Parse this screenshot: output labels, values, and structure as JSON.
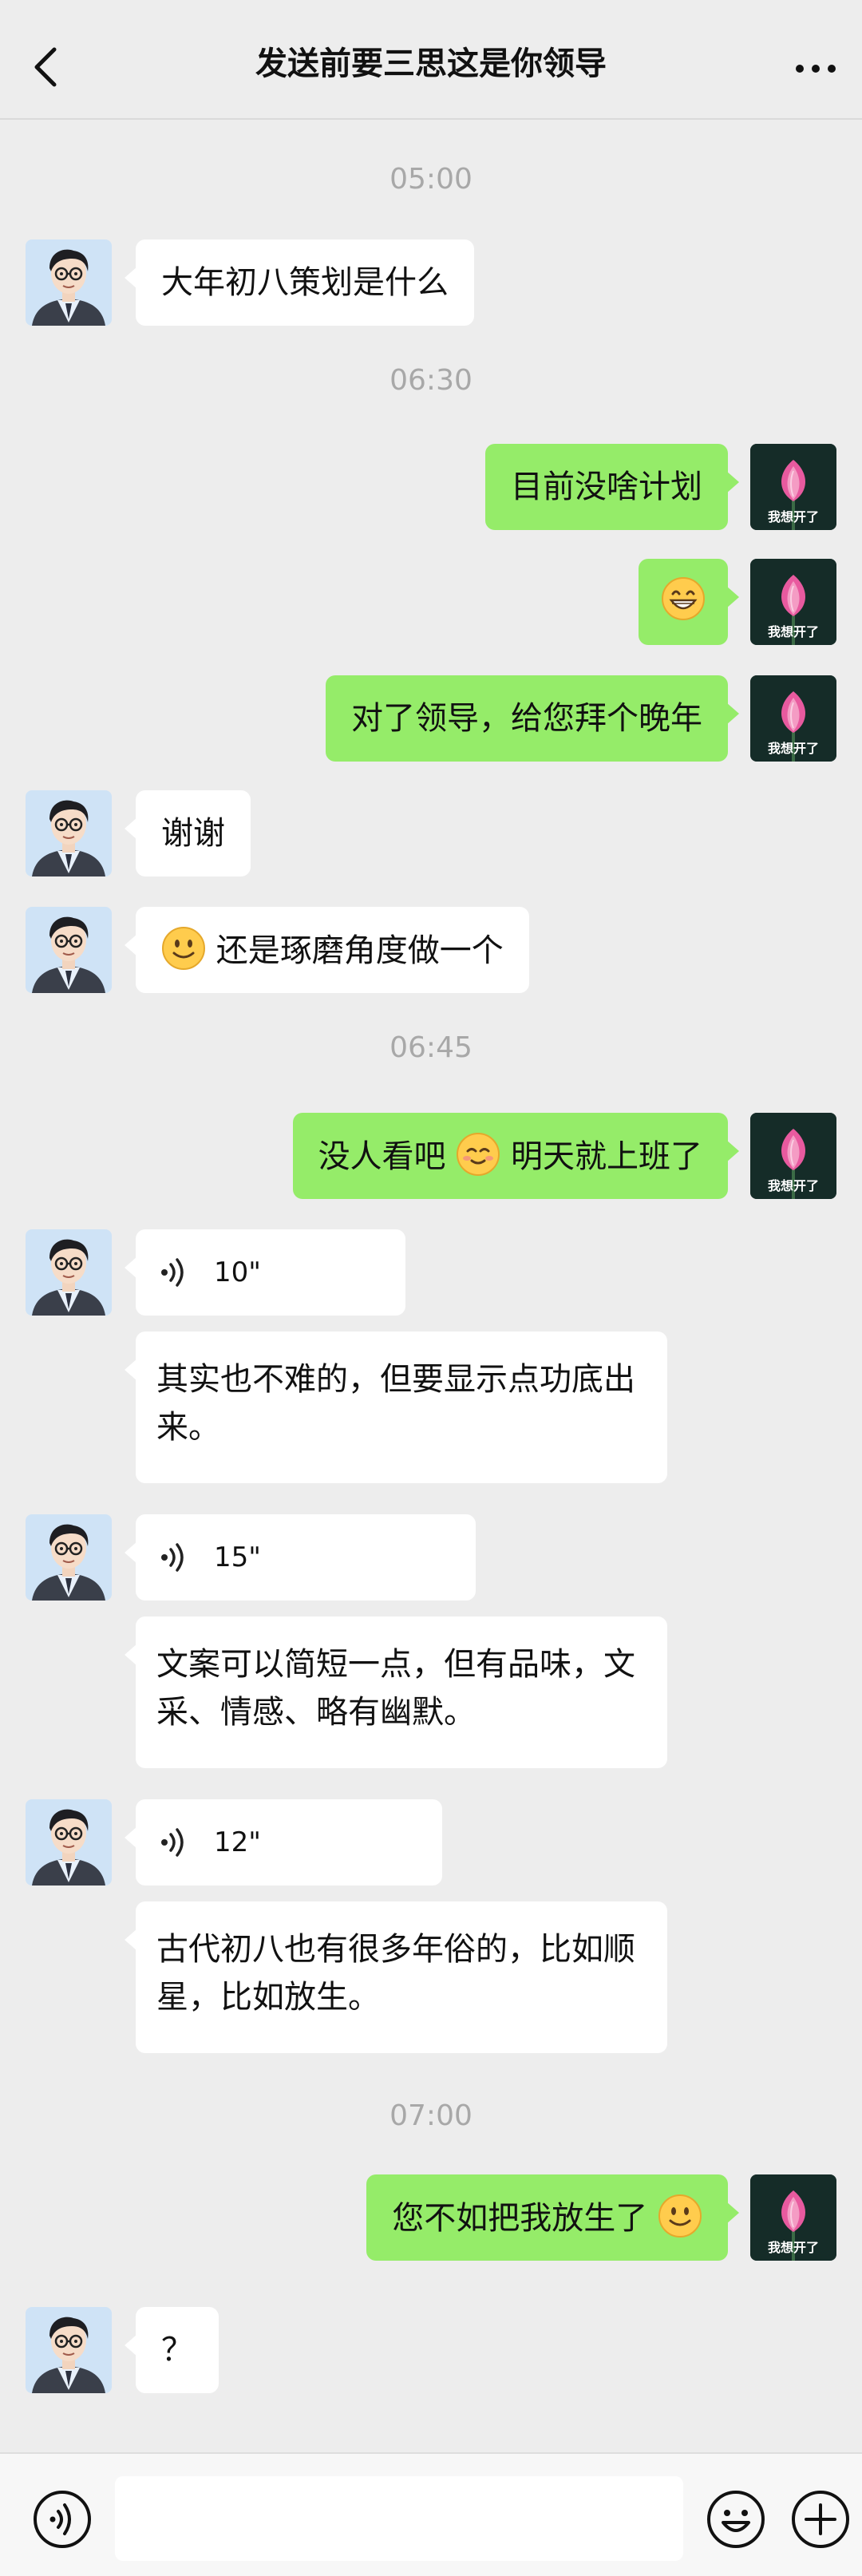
{
  "header": {
    "title": "发送前要三思这是你领导",
    "back_icon": "chevron-left-icon",
    "more_icon": "more-dots-icon"
  },
  "self_avatar_caption": "我想开了",
  "timestamps": [
    "05:00",
    "06:30",
    "06:45",
    "07:00"
  ],
  "messages": [
    {
      "side": "left",
      "type": "text",
      "text": "大年初八策划是什么"
    },
    {
      "side": "right",
      "type": "text",
      "text": "目前没啥计划"
    },
    {
      "side": "right",
      "type": "emoji",
      "emoji": "grinning-face-icon"
    },
    {
      "side": "right",
      "type": "text",
      "text": "对了领导，给您拜个晚年"
    },
    {
      "side": "left",
      "type": "text",
      "text": "谢谢"
    },
    {
      "side": "left",
      "type": "text",
      "text": "还是琢磨角度做一个",
      "emoji": "smiling-face-icon"
    },
    {
      "side": "right",
      "type": "text",
      "text_before": "没人看吧",
      "text_after": "明天就上班了",
      "emoji": "blushing-face-icon"
    },
    {
      "side": "left",
      "type": "voice",
      "duration": "10\""
    },
    {
      "side": "left",
      "type": "transcript",
      "text": "其实也不难的，但要显示点功底出来。"
    },
    {
      "side": "left",
      "type": "voice",
      "duration": "15\""
    },
    {
      "side": "left",
      "type": "transcript",
      "text": "文案可以简短一点，但有品味，文采、情感、略有幽默。"
    },
    {
      "side": "left",
      "type": "voice",
      "duration": "12\""
    },
    {
      "side": "left",
      "type": "transcript",
      "text": "古代初八也有很多年俗的，比如顺星，比如放生。"
    },
    {
      "side": "right",
      "type": "text",
      "text": "您不如把我放生了",
      "emoji": "smiling-face-icon"
    },
    {
      "side": "left",
      "type": "text",
      "text": "？"
    }
  ],
  "input": {
    "value": "",
    "placeholder": ""
  },
  "colors": {
    "background": "#EDEDED",
    "self_bubble": "#95EC69",
    "other_bubble": "#FFFFFF",
    "timestamp": "#A8A8A8"
  }
}
